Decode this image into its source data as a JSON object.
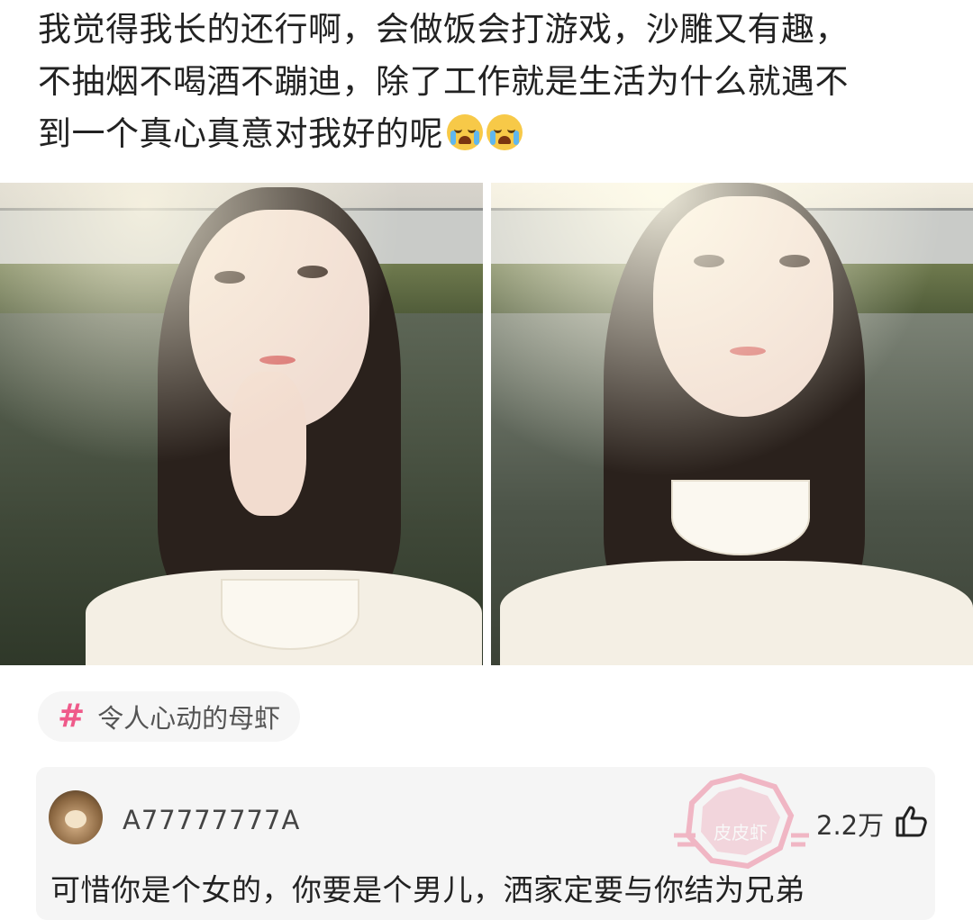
{
  "post": {
    "lines": [
      "我觉得我长的还行啊，会做饭会打游戏，沙雕又有趣，",
      "不抽烟不喝酒不蹦迪，除了工作就是生活为什么就遇不",
      "到一个真心真意对我好的呢"
    ],
    "emojis": [
      "crying-face-icon",
      "crying-face-icon"
    ]
  },
  "photos": [
    {
      "name": "photo-left"
    },
    {
      "name": "photo-right"
    }
  ],
  "topic_tag": {
    "symbol": "#",
    "label": "令人心动的母虾",
    "accent": "#ef5a8a"
  },
  "comment": {
    "username": "A77777777A",
    "likes": "2.2万",
    "text": "可惜你是个女的，你要是个男儿，洒家定要与你结为兄弟",
    "like_icon": "thumbs-up-icon",
    "avatar_icon": "dog-avatar"
  },
  "watermark": {
    "text": "皮皮虾",
    "color": "#e8436a"
  }
}
